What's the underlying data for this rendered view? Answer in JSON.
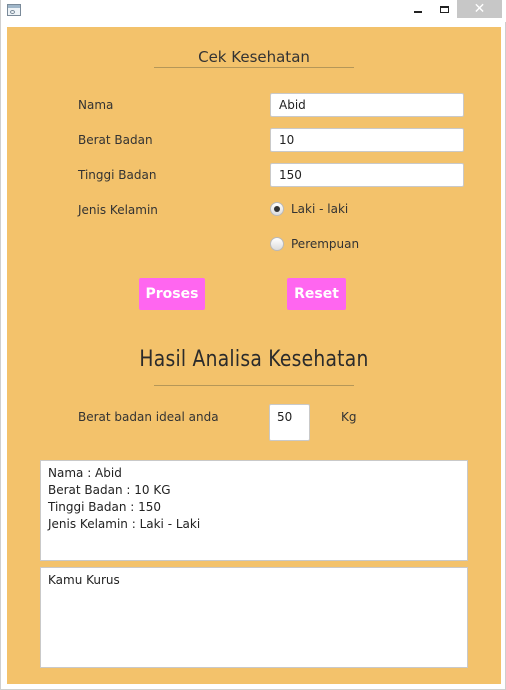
{
  "window": {
    "close_glyph": "✕",
    "icons": [
      "app-icon",
      "minimize-icon",
      "maximize-icon",
      "close-icon"
    ]
  },
  "form": {
    "title": "Cek Kesehatan",
    "nama_label": "Nama",
    "nama_value": "Abid",
    "berat_label": "Berat Badan",
    "berat_value": "10",
    "tinggi_label": "Tinggi Badan",
    "tinggi_value": "150",
    "jenis_label": "Jenis Kelamin",
    "options": [
      {
        "label": "Laki - laki",
        "selected": true
      },
      {
        "label": "Perempuan",
        "selected": false
      }
    ],
    "proses_label": "Proses",
    "reset_label": "Reset"
  },
  "result": {
    "title": "Hasil Analisa Kesehatan",
    "ideal_label": "Berat badan ideal anda",
    "ideal_value": "50",
    "ideal_unit": "Kg",
    "summary_lines": [
      "Nama : Abid",
      "Berat Badan : 10 KG",
      "Tinggi Badan : 150",
      "Jenis Kelamin : Laki - Laki"
    ],
    "status": "Kamu Kurus"
  },
  "colors": {
    "background": "#f3c26b",
    "button": "#ff66f0",
    "button_text": "#ffffff"
  }
}
